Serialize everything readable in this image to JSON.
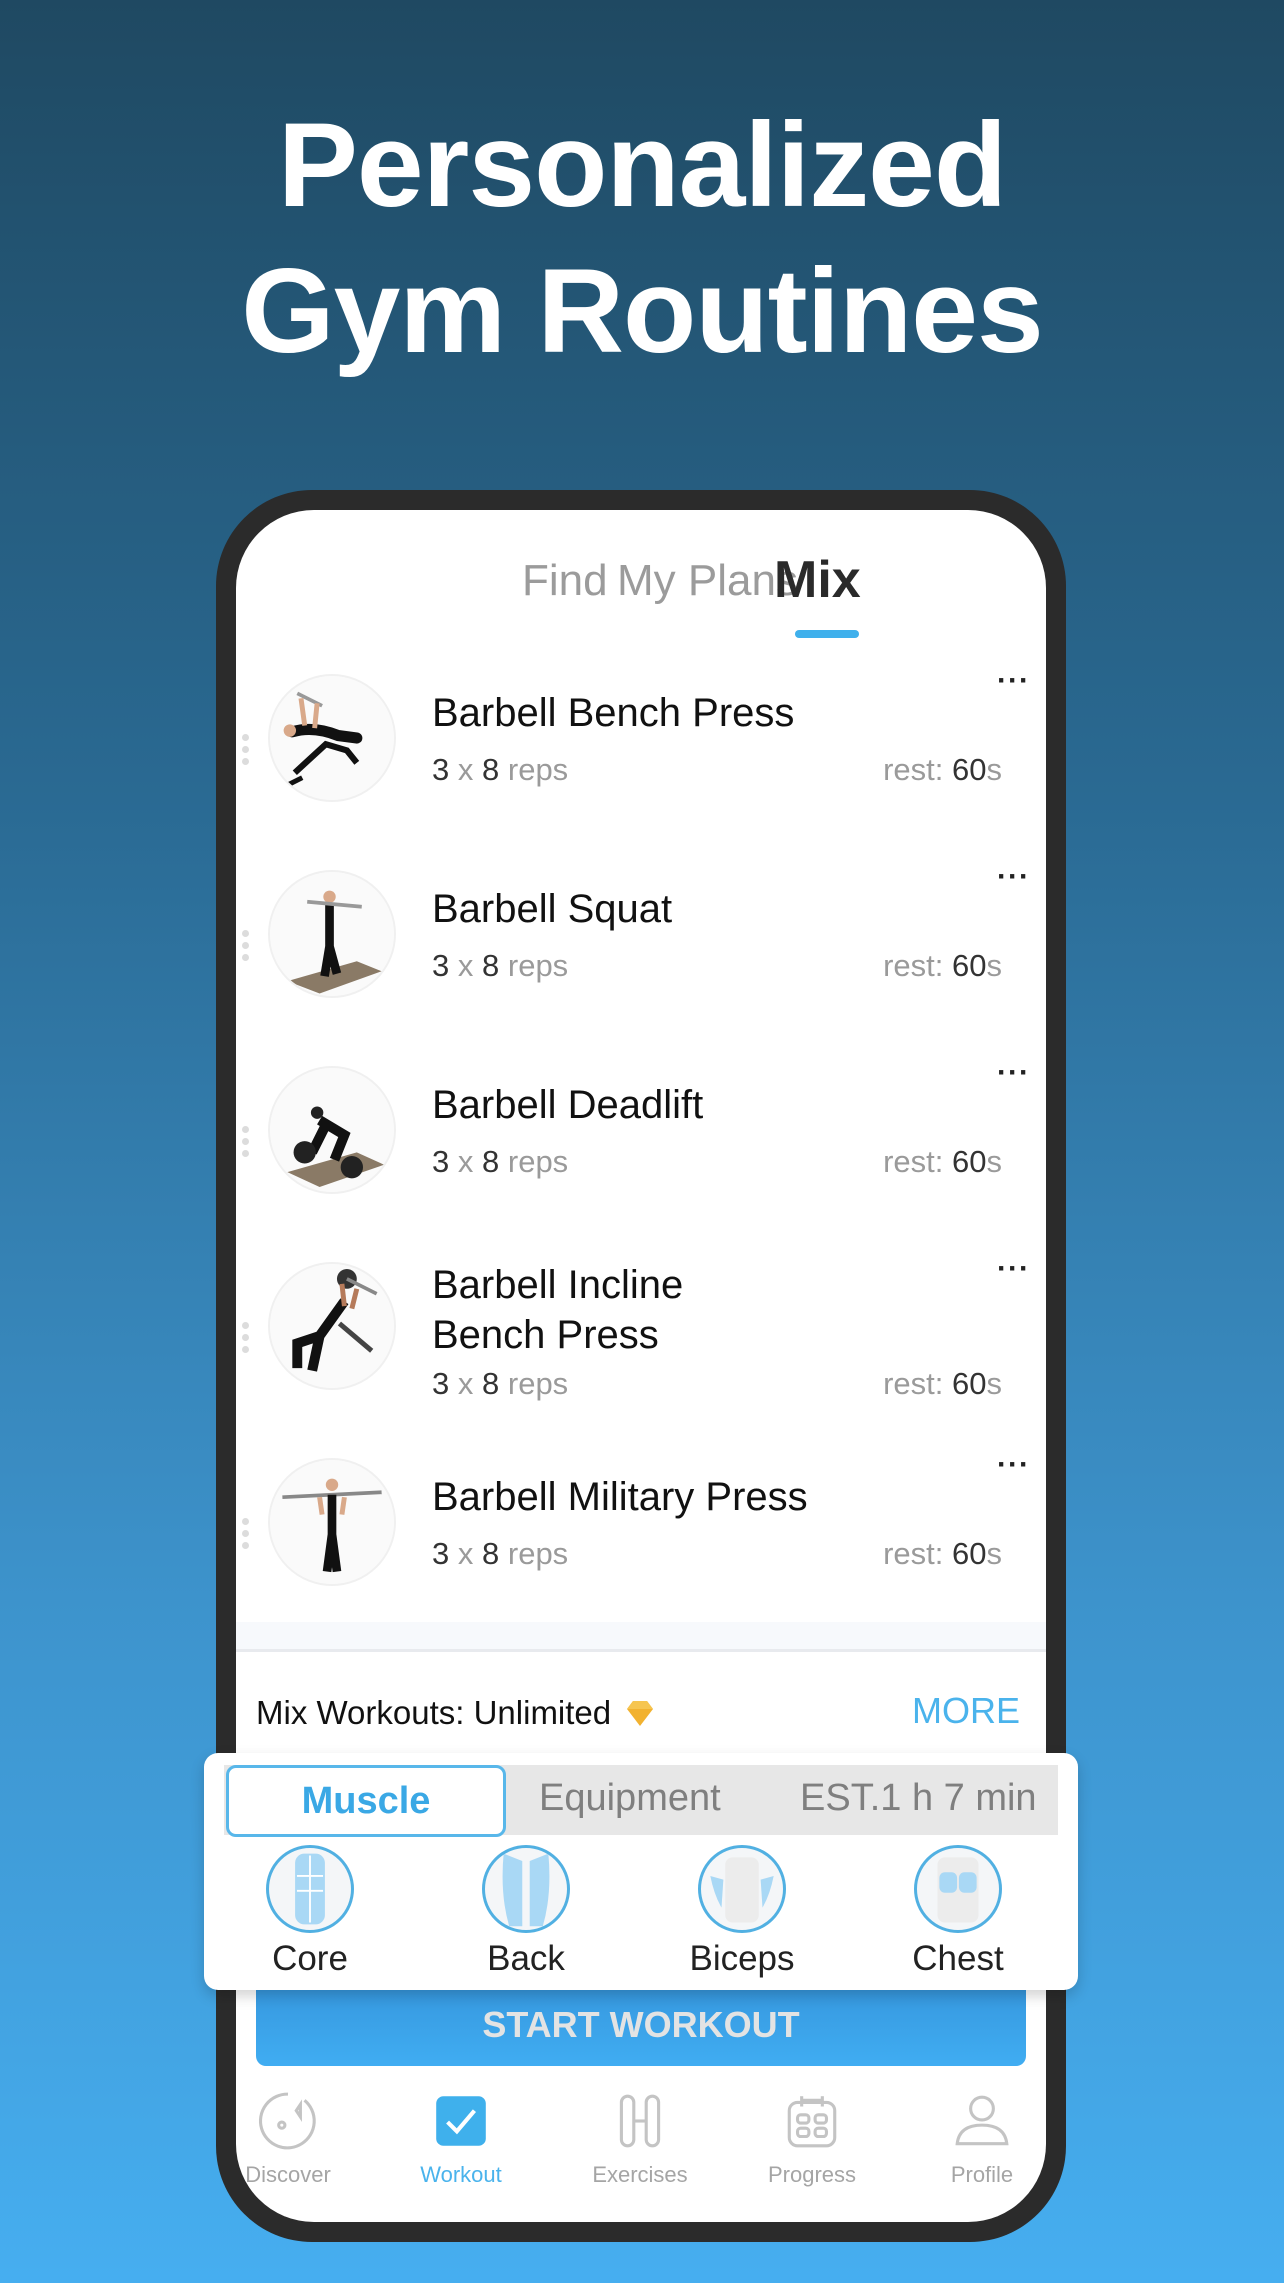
{
  "headline": {
    "line1": "Personalized",
    "line2": "Gym Routines"
  },
  "top_tabs": [
    {
      "label": "Find",
      "active": false
    },
    {
      "label": "My Plans",
      "active": false
    },
    {
      "label": "Mix",
      "active": true
    }
  ],
  "exercises": [
    {
      "title": "Barbell Bench Press",
      "sets": "3",
      "x": "x",
      "reps": "8",
      "reps_label": "reps",
      "rest_label": "rest:",
      "rest_value": "60",
      "rest_unit": "s",
      "image": "bench-press-image"
    },
    {
      "title": "Barbell Squat",
      "sets": "3",
      "x": "x",
      "reps": "8",
      "reps_label": "reps",
      "rest_label": "rest:",
      "rest_value": "60",
      "rest_unit": "s",
      "image": "squat-image"
    },
    {
      "title": "Barbell Deadlift",
      "sets": "3",
      "x": "x",
      "reps": "8",
      "reps_label": "reps",
      "rest_label": "rest:",
      "rest_value": "60",
      "rest_unit": "s",
      "image": "deadlift-image"
    },
    {
      "title_line1": "Barbell Incline",
      "title_line2": "Bench Press",
      "sets": "3",
      "x": "x",
      "reps": "8",
      "reps_label": "reps",
      "rest_label": "rest:",
      "rest_value": "60",
      "rest_unit": "s",
      "image": "incline-bench-press-image"
    },
    {
      "title": "Barbell Military Press",
      "sets": "3",
      "x": "x",
      "reps": "8",
      "reps_label": "reps",
      "rest_label": "rest:",
      "rest_value": "60",
      "rest_unit": "s",
      "image": "military-press-image"
    }
  ],
  "more_menu_glyph": "···",
  "mix_status": {
    "label": "Mix Workouts: Unlimited",
    "icon": "diamond-icon",
    "more_label": "MORE"
  },
  "selector": {
    "tabs": [
      {
        "label": "Muscle",
        "active": true
      },
      {
        "label": "Equipment",
        "active": false
      }
    ],
    "estimate": "EST.1 h 7 min",
    "muscles": [
      {
        "label": "Core"
      },
      {
        "label": "Back"
      },
      {
        "label": "Biceps"
      },
      {
        "label": "Chest"
      }
    ]
  },
  "start_button": "START WORKOUT",
  "bottom_nav": [
    {
      "label": "Discover",
      "icon": "compass-icon",
      "active": false
    },
    {
      "label": "Workout",
      "icon": "checkbox-icon",
      "active": true
    },
    {
      "label": "Exercises",
      "icon": "dumbbell-icon",
      "active": false
    },
    {
      "label": "Progress",
      "icon": "calendar-icon",
      "active": false
    },
    {
      "label": "Profile",
      "icon": "person-icon",
      "active": false
    }
  ],
  "colors": {
    "accent": "#3fb0ec",
    "bg_top": "#1f4962",
    "bg_bottom": "#46aef0",
    "phone_frame": "#2b2b2b",
    "diamond": "#f2b230"
  }
}
